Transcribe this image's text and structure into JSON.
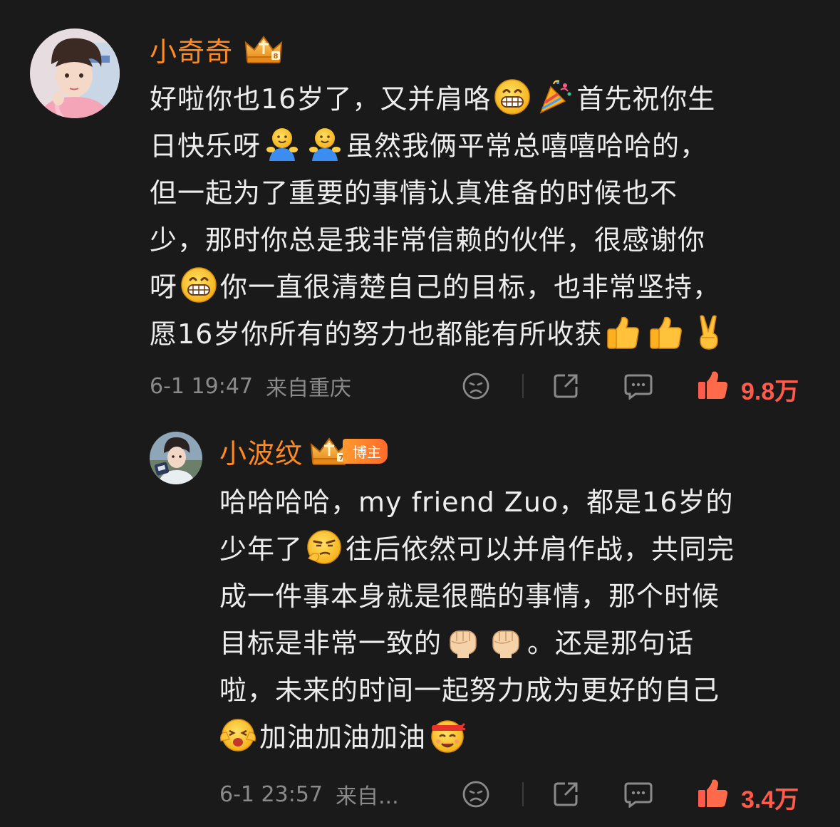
{
  "comment1": {
    "username": "小奇奇",
    "lines": [
      [
        "好啦你也16岁了，又并肩咯",
        "grin",
        "party",
        "首先祝你生"
      ],
      [
        "日快乐呀",
        "hug",
        "hug",
        "虽然我俩平常总嘻嘻哈哈的，"
      ],
      [
        "但一起为了重要的事情认真准备的时候也不"
      ],
      [
        "少，那时你总是我非常信赖的伙伴，很感谢你"
      ],
      [
        "呀",
        "grin",
        "你一直很清楚自己的目标，也非常坚持，"
      ],
      [
        "愿16岁你所有的努力也都能有所收获",
        "thumb",
        "thumb",
        "victory"
      ]
    ],
    "timestamp": "6-1 19:47",
    "location": "来自重庆",
    "like_count": "9.8万"
  },
  "comment2": {
    "username": "小波纹",
    "badge_label": "博主",
    "lines": [
      [
        "哈哈哈哈，my friend Zuo，都是16岁的"
      ],
      [
        "少年了",
        "smirk",
        "往后依然可以并肩作战，共同完"
      ],
      [
        "成一件事本身就是很酷的事情，那个时候"
      ],
      [
        "目标是非常一致的",
        "fist",
        "fist",
        "。还是那句话"
      ],
      [
        "啦，未来的时间一起努力成为更好的自己"
      ],
      [
        "cheer",
        "加油加油加油",
        "fighting"
      ]
    ],
    "timestamp": "6-1 23:57",
    "location": "来自...",
    "like_count": "3.4万"
  },
  "colors": {
    "background": "#1a1a1a",
    "username": "#ff8a1f",
    "text": "#ededed",
    "meta": "#8a8a8a",
    "like": "#ff5a4a"
  },
  "icons": [
    "dislike-icon",
    "share-icon",
    "reply-icon",
    "like-icon",
    "crown-badge-icon"
  ]
}
